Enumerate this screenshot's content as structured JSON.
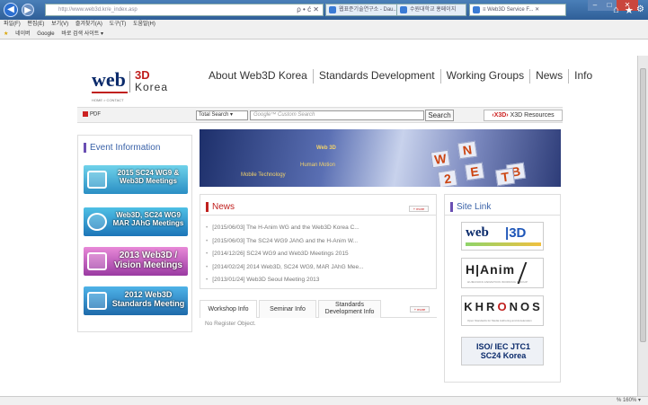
{
  "browser": {
    "address": "http://www.web3d.kr/e_index.asp",
    "address_tools": "ρ • ć ✕",
    "tabs": [
      {
        "label": "웹표준기술연구소 - Dau..."
      },
      {
        "label": "수원대학교 홍페이지"
      },
      {
        "label": "≡ Web3D Service F...  ✕"
      }
    ],
    "menu": [
      "파일(F)",
      "편집(E)",
      "보기(V)",
      "즐겨찾기(A)",
      "도구(T)",
      "도움말(H)"
    ],
    "favorites": [
      "네이버",
      "Google",
      "바로 검색 사이트 ▾"
    ],
    "zoom": "% 160%  ▾"
  },
  "site": {
    "logo": {
      "web": "web",
      "three_d": "3D",
      "korea": "Korea"
    },
    "crumb": "HOME > CONTACT",
    "nav": [
      "About Web3D Korea",
      "Standards Development",
      "Working Groups",
      "News",
      "Info"
    ],
    "pdf": "PDF",
    "search_select": "Total Search  ▾",
    "search_placeholder": "Google™ Custom Search",
    "search_button": "Search",
    "x3d": "X3D Resources",
    "event_title": "Event Information",
    "events": [
      "2015 SC24 WG9 &\nWeb3D Meetings",
      "Web3D, SC24 WG9\nMAR JAhG Meetings",
      "2013 Web3D /\nVision Meetings",
      "2012 Web3D\nStandards Meeting"
    ],
    "hero": {
      "t1": "Web 3D",
      "t2": "Human Motion",
      "t3": "Mobile Technology"
    },
    "news_title": "News",
    "more": "+ more",
    "news": [
      "[2015/06/03] The H-Anim WG and the Web3D Korea C...",
      "[2015/06/03] The SC24 WG9 JAhG and the H-Anim W...",
      "[2014/12/26] SC24 WG9 and Web3D Meetings 2015",
      "[2014/02/24] 2014 Web3D, SC24 WG9, MAR JAhG Mee...",
      "[2013/01/24] Web3D Seoul Meeting 2013"
    ],
    "tabs": [
      "Workshop Info",
      "Seminar Info",
      "Standards Development Info"
    ],
    "no_register": "No Register Object.",
    "sitelink_title": "Site Link",
    "sitelinks": {
      "web3d_a": "web",
      "web3d_b": "|3D",
      "hanim": "H|Anim",
      "hanim_sub": "HUMANOID ANIMATION WORKING GROUP",
      "khronos": "KHR",
      "khronos_o": "O",
      "khronos_rest": "NOS",
      "khronos_sub": "Open Standards for Media Authoring and Acceleration",
      "iso": "ISO/ IEC JTC1\nSC24 Korea"
    }
  }
}
